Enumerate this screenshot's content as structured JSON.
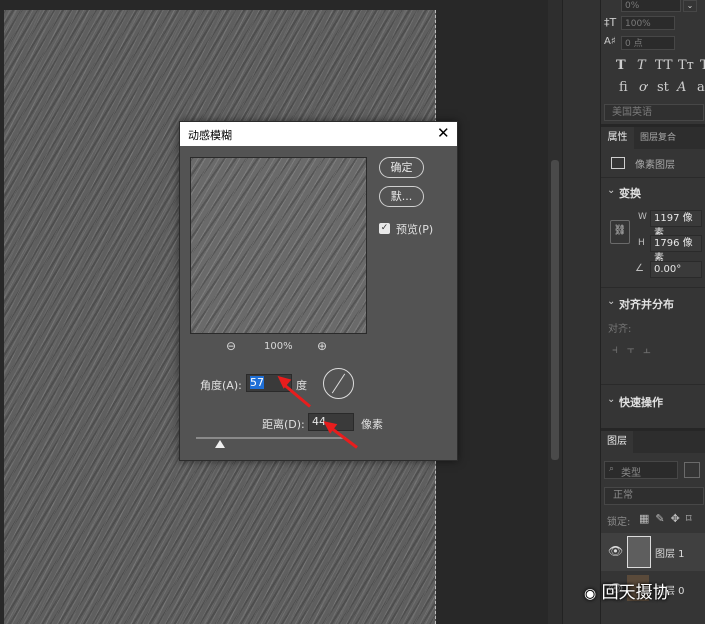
{
  "right_panel": {
    "top_fields": [
      "0%",
      "100%",
      "0 点"
    ],
    "glyph_row1": [
      "T",
      "T",
      "TT",
      "Tт",
      "T"
    ],
    "glyph_row2": [
      "fi",
      "ơ",
      "st",
      "A",
      "a"
    ],
    "language": "美国英语",
    "properties_tabs": [
      "属性",
      "图层复合"
    ],
    "pixel_layer_label": "像素图层",
    "transform_title": "变换",
    "width_label": "W",
    "width_value": "1197 像素",
    "height_label": "H",
    "height_value": "1796 像素",
    "angle_value": "0.00°",
    "align_title": "对齐并分布",
    "align_label": "对齐:",
    "quick_actions_title": "快速操作",
    "layers_tab": "图层",
    "layer_filter": "类型",
    "blend_mode": "正常",
    "lock_label": "锁定:",
    "layers": [
      {
        "name": "图层 1"
      },
      {
        "name": "图层 0"
      }
    ]
  },
  "dialog": {
    "title": "动感模糊",
    "ok_label": "确定",
    "cancel_label": "默...",
    "preview_label": "预览(P)",
    "preview_checked": true,
    "zoom_level": "100%",
    "angle_label": "角度(A):",
    "angle_value": "57",
    "angle_unit": "度",
    "distance_label": "距离(D):",
    "distance_value": "44",
    "distance_unit": "像素",
    "slider_fraction": 0.16
  },
  "watermark": "回天摄协",
  "colors": {
    "arrow": "#e81d1d",
    "selection": "#1f6fd6"
  }
}
